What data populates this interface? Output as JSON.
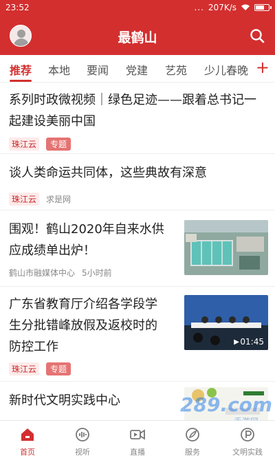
{
  "status_bar": {
    "time": "23:52",
    "dots": "...",
    "speed": "207K/s"
  },
  "header": {
    "title": "最鹤山",
    "avatar_icon": "user-avatar-icon",
    "search_icon": "search-icon"
  },
  "tabs": [
    {
      "label": "推荐",
      "active": true
    },
    {
      "label": "本地"
    },
    {
      "label": "要闻"
    },
    {
      "label": "党建"
    },
    {
      "label": "艺苑"
    },
    {
      "label": "少儿春晚"
    }
  ],
  "tab_add": "+",
  "articles": [
    {
      "title_lines": [
        "系列时政微视频｜绿色足迹——跟着总书记一",
        "起建设美丽中国"
      ],
      "source": "珠江云",
      "tag": "专题"
    },
    {
      "title_lines": [
        "谈人类命运共同体，这些典故有深意"
      ],
      "source": "珠江云",
      "source2": "求是网"
    },
    {
      "title_lines": [
        "围观！鹤山2020年自来水供",
        "应成绩单出炉！"
      ],
      "source": "鹤山市融媒体中心",
      "time": "5小时前"
    },
    {
      "title_lines": [
        "广东省教育厅介绍各学段学",
        "生分批错峰放假及返校时的",
        "防控工作"
      ],
      "source": "珠江云",
      "tag": "专题",
      "video_duration": "01:45"
    },
    {
      "title_lines": [
        "新时代文明实践中心"
      ]
    }
  ],
  "bottom_nav": [
    {
      "label": "首页",
      "icon": "home-icon",
      "active": true
    },
    {
      "label": "视听",
      "icon": "audio-icon"
    },
    {
      "label": "直播",
      "icon": "live-icon"
    },
    {
      "label": "服务",
      "icon": "service-icon"
    },
    {
      "label": "文明实践",
      "icon": "practice-icon"
    }
  ],
  "watermark": {
    "logo": "289.com",
    "text": "手游网"
  },
  "colors": {
    "brand": "#d32f2f",
    "tag_bg": "#e57373"
  }
}
